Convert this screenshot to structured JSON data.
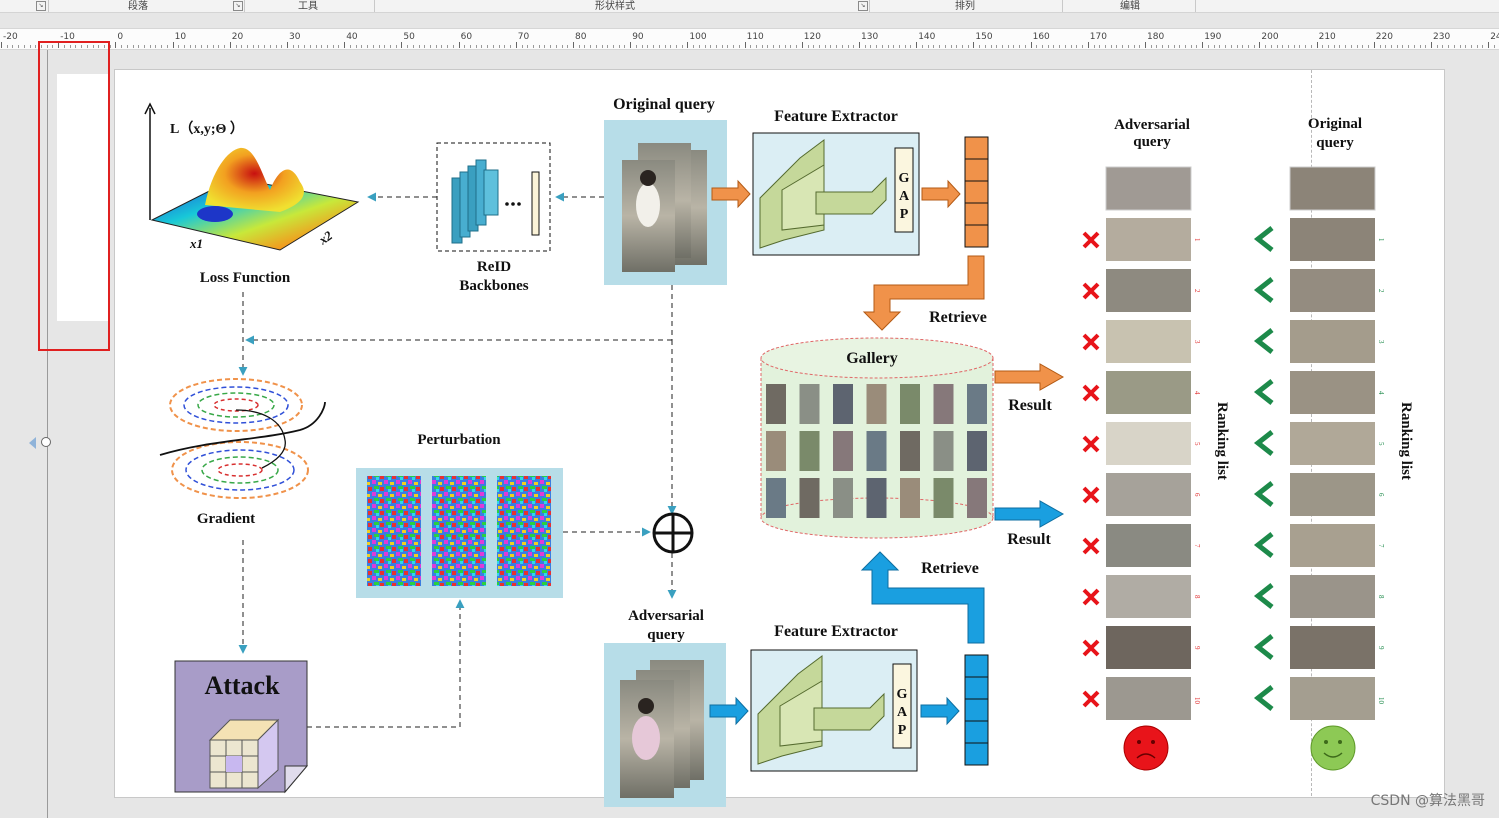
{
  "ribbon": {
    "groups": [
      {
        "label": "段落"
      },
      {
        "label": "工具"
      },
      {
        "label": "形状样式"
      },
      {
        "label": "排列"
      },
      {
        "label": "编辑"
      }
    ]
  },
  "ruler": {
    "labels": [
      "-20",
      "-10",
      "0",
      "10",
      "20",
      "30",
      "40",
      "50",
      "60",
      "70",
      "80",
      "90",
      "100",
      "110",
      "120",
      "130",
      "140",
      "150",
      "160",
      "170",
      "180",
      "190",
      "200",
      "210",
      "220",
      "230",
      "240"
    ]
  },
  "diagram": {
    "loss_axis_label": "L（x,y;Θ ）",
    "loss_x1": "x1",
    "loss_x2": "x2",
    "loss_title": "Loss Function",
    "reid_title_1": "ReID",
    "reid_title_2": "Backbones",
    "original_query_title": "Original query",
    "feature_extractor_top": "Feature Extractor",
    "feature_extractor_bottom": "Feature Extractor",
    "gap_letters": [
      "G",
      "A",
      "P"
    ],
    "retrieve_top": "Retrieve",
    "retrieve_bottom": "Retrieve",
    "gallery_title": "Gallery",
    "result_top": "Result",
    "result_bottom": "Result",
    "gradient_title": "Gradient",
    "perturbation_title": "Perturbation",
    "adversarial_query_title_1": "Adversarial",
    "adversarial_query_title_2": "query",
    "attack_title": "Attack",
    "col_adv_title_1": "Adversarial",
    "col_adv_title_2": "query",
    "col_orig_title_1": "Original",
    "col_orig_title_2": "query",
    "ranking_list_left": "Ranking list",
    "ranking_list_right": "Ranking list",
    "rank_numbers": [
      "1",
      "2",
      "3",
      "4",
      "5",
      "6",
      "7",
      "8",
      "9",
      "10"
    ]
  },
  "colors": {
    "orange": "#f0924a",
    "blue": "#1a9fe0",
    "light_blue_panel": "#b7dde8",
    "feature_box": "#dbeef4",
    "cuboid_green": "#c5d89a",
    "attack_purple": "#a89cc8",
    "sad_face": "#e8141a",
    "happy_face": "#8dc955",
    "wrong_mark": "#e8141a",
    "check_mark": "#1d8a4a",
    "selection_frame": "#e02020"
  },
  "watermark": "CSDN @算法黑哥"
}
